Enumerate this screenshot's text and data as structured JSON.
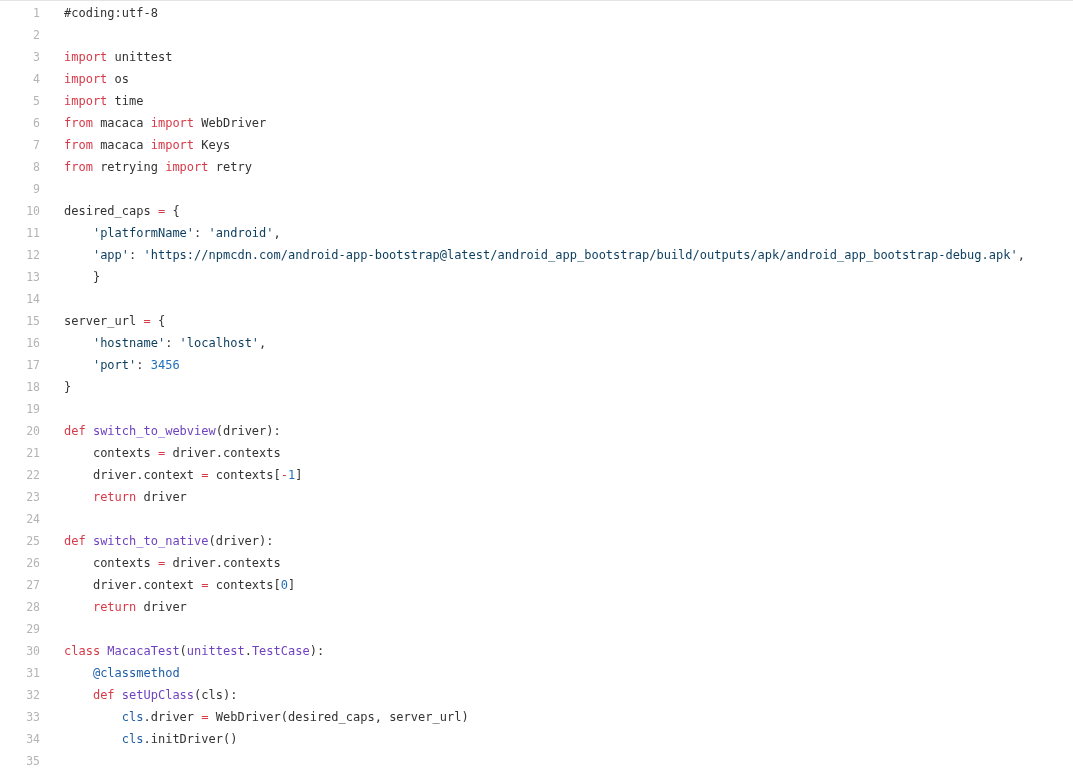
{
  "code_lines": [
    {
      "number": "1",
      "tokens": [
        {
          "kind": "plain",
          "text": "#coding:utf-8"
        }
      ]
    },
    {
      "number": "2"
    },
    {
      "number": "3",
      "tokens": [
        {
          "kind": "keyword",
          "text": "import"
        },
        {
          "kind": "plain",
          "text": " unittest"
        }
      ]
    },
    {
      "number": "4",
      "tokens": [
        {
          "kind": "keyword",
          "text": "import"
        },
        {
          "kind": "plain",
          "text": " os"
        }
      ]
    },
    {
      "number": "5",
      "tokens": [
        {
          "kind": "keyword",
          "text": "import"
        },
        {
          "kind": "plain",
          "text": " time"
        }
      ]
    },
    {
      "number": "6",
      "tokens": [
        {
          "kind": "keyword",
          "text": "from"
        },
        {
          "kind": "plain",
          "text": " macaca "
        },
        {
          "kind": "keyword",
          "text": "import"
        },
        {
          "kind": "plain",
          "text": " WebDriver"
        }
      ]
    },
    {
      "number": "7",
      "tokens": [
        {
          "kind": "keyword",
          "text": "from"
        },
        {
          "kind": "plain",
          "text": " macaca "
        },
        {
          "kind": "keyword",
          "text": "import"
        },
        {
          "kind": "plain",
          "text": " Keys"
        }
      ]
    },
    {
      "number": "8",
      "tokens": [
        {
          "kind": "keyword",
          "text": "from"
        },
        {
          "kind": "plain",
          "text": " retrying "
        },
        {
          "kind": "keyword",
          "text": "import"
        },
        {
          "kind": "plain",
          "text": " retry"
        }
      ]
    },
    {
      "number": "9"
    },
    {
      "number": "10",
      "tokens": [
        {
          "kind": "plain",
          "text": "desired_caps "
        },
        {
          "kind": "operator",
          "text": "="
        },
        {
          "kind": "plain",
          "text": " {"
        }
      ]
    },
    {
      "number": "11",
      "tokens": [
        {
          "kind": "string",
          "text": "    'platformName'"
        },
        {
          "kind": "plain",
          "text": ": "
        },
        {
          "kind": "string",
          "text": "'android'"
        },
        {
          "kind": "plain",
          "text": ","
        }
      ]
    },
    {
      "number": "12",
      "tokens": [
        {
          "kind": "string",
          "text": "    'app'"
        },
        {
          "kind": "plain",
          "text": ": "
        },
        {
          "kind": "string",
          "text": "'https://npmcdn.com/android-app-bootstrap@latest/android_app_bootstrap/build/outputs/apk/android_app_bootstrap-debug.apk'"
        },
        {
          "kind": "plain",
          "text": ","
        }
      ]
    },
    {
      "number": "13",
      "tokens": [
        {
          "kind": "plain",
          "text": "    }"
        }
      ]
    },
    {
      "number": "14"
    },
    {
      "number": "15",
      "tokens": [
        {
          "kind": "plain",
          "text": "server_url "
        },
        {
          "kind": "operator",
          "text": "="
        },
        {
          "kind": "plain",
          "text": " {"
        }
      ]
    },
    {
      "number": "16",
      "tokens": [
        {
          "kind": "string",
          "text": "    'hostname'"
        },
        {
          "kind": "plain",
          "text": ": "
        },
        {
          "kind": "string",
          "text": "'localhost'"
        },
        {
          "kind": "plain",
          "text": ","
        }
      ]
    },
    {
      "number": "17",
      "tokens": [
        {
          "kind": "string",
          "text": "    'port'"
        },
        {
          "kind": "plain",
          "text": ": "
        },
        {
          "kind": "number",
          "text": "3456"
        }
      ]
    },
    {
      "number": "18",
      "tokens": [
        {
          "kind": "plain",
          "text": "}"
        }
      ]
    },
    {
      "number": "19"
    },
    {
      "number": "20",
      "tokens": [
        {
          "kind": "keyword",
          "text": "def "
        },
        {
          "kind": "function",
          "text": "switch_to_webview"
        },
        {
          "kind": "plain",
          "text": "(driver):"
        }
      ]
    },
    {
      "number": "21",
      "tokens": [
        {
          "kind": "plain",
          "text": "    contexts "
        },
        {
          "kind": "operator",
          "text": "="
        },
        {
          "kind": "plain",
          "text": " driver.contexts"
        }
      ]
    },
    {
      "number": "22",
      "tokens": [
        {
          "kind": "plain",
          "text": "    driver.context "
        },
        {
          "kind": "operator",
          "text": "="
        },
        {
          "kind": "plain",
          "text": " contexts["
        },
        {
          "kind": "operator",
          "text": "-"
        },
        {
          "kind": "number",
          "text": "1"
        },
        {
          "kind": "plain",
          "text": "]"
        }
      ]
    },
    {
      "number": "23",
      "tokens": [
        {
          "kind": "keyword",
          "text": "    return"
        },
        {
          "kind": "plain",
          "text": " driver"
        }
      ]
    },
    {
      "number": "24"
    },
    {
      "number": "25",
      "tokens": [
        {
          "kind": "keyword",
          "text": "def "
        },
        {
          "kind": "function",
          "text": "switch_to_native"
        },
        {
          "kind": "plain",
          "text": "(driver):"
        }
      ]
    },
    {
      "number": "26",
      "tokens": [
        {
          "kind": "plain",
          "text": "    contexts "
        },
        {
          "kind": "operator",
          "text": "="
        },
        {
          "kind": "plain",
          "text": " driver.contexts"
        }
      ]
    },
    {
      "number": "27",
      "tokens": [
        {
          "kind": "plain",
          "text": "    driver.context "
        },
        {
          "kind": "operator",
          "text": "="
        },
        {
          "kind": "plain",
          "text": " contexts["
        },
        {
          "kind": "number",
          "text": "0"
        },
        {
          "kind": "plain",
          "text": "]"
        }
      ]
    },
    {
      "number": "28",
      "tokens": [
        {
          "kind": "keyword",
          "text": "    return"
        },
        {
          "kind": "plain",
          "text": " driver"
        }
      ]
    },
    {
      "number": "29"
    },
    {
      "number": "30",
      "tokens": [
        {
          "kind": "keyword",
          "text": "class "
        },
        {
          "kind": "function",
          "text": "MacacaTest"
        },
        {
          "kind": "plain",
          "text": "("
        },
        {
          "kind": "function",
          "text": "unittest"
        },
        {
          "kind": "plain",
          "text": "."
        },
        {
          "kind": "function",
          "text": "TestCase"
        },
        {
          "kind": "plain",
          "text": "):"
        }
      ]
    },
    {
      "number": "31",
      "tokens": [
        {
          "kind": "decorator",
          "text": "    @classmethod"
        }
      ]
    },
    {
      "number": "32",
      "tokens": [
        {
          "kind": "keyword",
          "text": "    def "
        },
        {
          "kind": "function",
          "text": "setUpClass"
        },
        {
          "kind": "plain",
          "text": "(cls):"
        }
      ]
    },
    {
      "number": "33",
      "tokens": [
        {
          "kind": "variable",
          "text": "        cls"
        },
        {
          "kind": "plain",
          "text": ".driver "
        },
        {
          "kind": "operator",
          "text": "="
        },
        {
          "kind": "plain",
          "text": " WebDriver(desired_caps, server_url)"
        }
      ]
    },
    {
      "number": "34",
      "tokens": [
        {
          "kind": "variable",
          "text": "        cls"
        },
        {
          "kind": "plain",
          "text": ".initDriver()"
        }
      ]
    },
    {
      "number": "35"
    }
  ]
}
